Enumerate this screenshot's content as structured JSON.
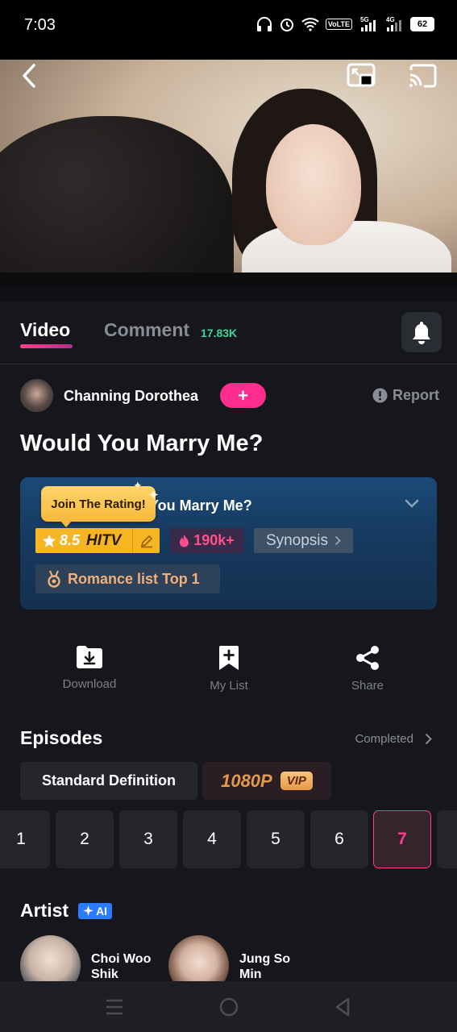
{
  "status_bar": {
    "time": "7:03",
    "volte": "VoLTE",
    "sig1": "5G",
    "sig2": "4G",
    "battery": "62"
  },
  "tabs": {
    "video": "Video",
    "comment": "Comment",
    "comment_count": "17.83K"
  },
  "uploader": {
    "name": "Channing Dorothea",
    "follow": "+",
    "report": "Report"
  },
  "show": {
    "title": "Would You Marry Me?"
  },
  "card": {
    "title_partial": "You Marry Me?",
    "rating_prompt": "Join The Rating!",
    "rating_value": "8.5",
    "rating_brand": "HITV",
    "heat": "190k+",
    "synopsis": "Synopsis",
    "rank": "Romance list Top 1"
  },
  "actions": {
    "download": "Download",
    "my_list": "My List",
    "share": "Share"
  },
  "episodes": {
    "title": "Episodes",
    "status": "Completed",
    "def_standard": "Standard Definition",
    "def_hd": "1080P",
    "vip": "VIP",
    "list": [
      "1",
      "2",
      "3",
      "4",
      "5",
      "6",
      "7"
    ],
    "selected": "7"
  },
  "artist": {
    "title": "Artist",
    "ai": "AI",
    "people": [
      {
        "name": "Choi Woo Shik"
      },
      {
        "name": "Jung So Min"
      }
    ]
  },
  "colors": {
    "accent": "#ff2e8e",
    "rating": "#f6b623",
    "comment_count": "#3dd598"
  }
}
